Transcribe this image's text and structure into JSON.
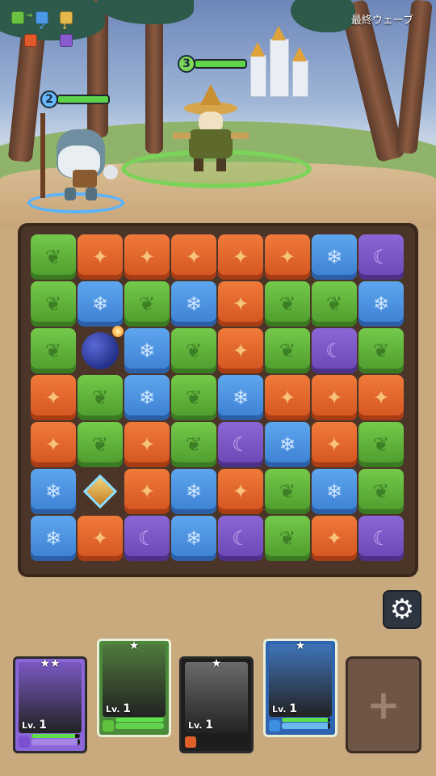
{
  "hud": {
    "wave_label": "最終ウェーブ",
    "element_chart": [
      "green",
      "blue",
      "orange",
      "yellow",
      "purple",
      "white"
    ]
  },
  "enemies": [
    {
      "name": "ice-troll",
      "level": "2",
      "hp_fraction": 1.0
    },
    {
      "name": "scarecrow",
      "level": "3",
      "hp_fraction": 1.0
    }
  ],
  "board": {
    "rows": [
      [
        "green",
        "orange",
        "orange",
        "orange",
        "orange",
        "orange",
        "blue",
        "purple"
      ],
      [
        "green",
        "blue",
        "green",
        "blue",
        "orange",
        "green",
        "green",
        "blue"
      ],
      [
        "green",
        "bomb",
        "blue",
        "green",
        "orange",
        "green",
        "purple",
        "green"
      ],
      [
        "orange",
        "green",
        "blue",
        "green",
        "blue",
        "orange",
        "orange",
        "orange"
      ],
      [
        "orange",
        "green",
        "orange",
        "green",
        "purple",
        "blue",
        "orange",
        "green"
      ],
      [
        "blue",
        "gem",
        "orange",
        "blue",
        "orange",
        "green",
        "blue",
        "green"
      ],
      [
        "blue",
        "orange",
        "purple",
        "blue",
        "purple",
        "green",
        "orange",
        "purple"
      ]
    ],
    "symbols": {
      "green": "❦",
      "orange": "✦",
      "blue": "❄",
      "purple": "☾"
    }
  },
  "settings": {
    "icon": "gear-icon"
  },
  "heroes": [
    {
      "stars": "★★",
      "level_prefix": "Lv.",
      "level": "1",
      "element": "purple",
      "hp_fraction": 0.95,
      "mp_fraction": 0.9,
      "portrait_color": "#7a58c2"
    },
    {
      "stars": "★",
      "level_prefix": "Lv.",
      "level": "1",
      "element": "green",
      "hp_fraction": 1.0,
      "mp_fraction": 1.0,
      "portrait_color": "#4f7a3c"
    },
    {
      "stars": "★",
      "level_prefix": "Lv.",
      "level": "1",
      "element": "orange",
      "hp_fraction": 0.0,
      "mp_fraction": 0.0,
      "portrait_color": "#6a6a6a"
    },
    {
      "stars": "★",
      "level_prefix": "Lv.",
      "level": "1",
      "element": "blue",
      "hp_fraction": 0.95,
      "mp_fraction": 0.95,
      "portrait_color": "#3f74b8"
    }
  ],
  "add_slot": {
    "label": "+"
  }
}
